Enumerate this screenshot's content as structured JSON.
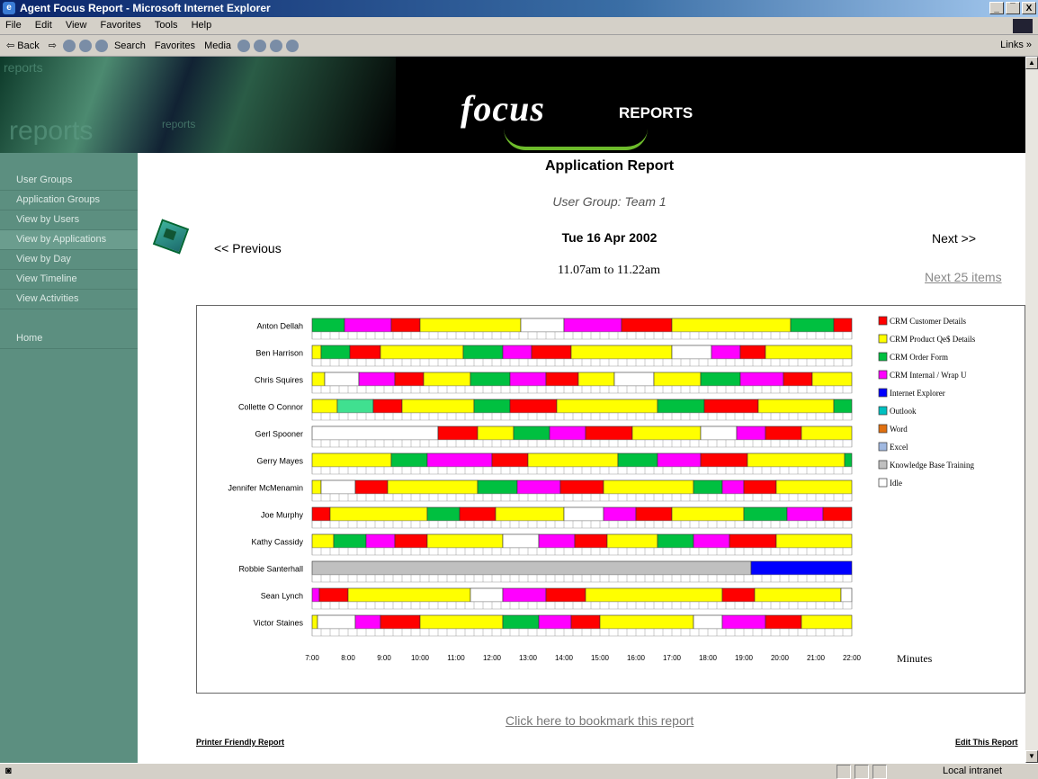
{
  "window": {
    "title": "Agent Focus Report - Microsoft Internet Explorer",
    "controls": [
      "_",
      "̅",
      "X"
    ]
  },
  "menu": [
    "File",
    "Edit",
    "View",
    "Favorites",
    "Tools",
    "Help"
  ],
  "toolbar": {
    "back": "⇦ Back",
    "forward": "⇨",
    "search": "Search",
    "favorites": "Favorites",
    "media": "Media",
    "links": "Links »"
  },
  "banner": {
    "brand": "focus",
    "subtitle": "REPORTS",
    "watermark": "reports"
  },
  "sidebar": {
    "items": [
      "User Groups",
      "Application Groups",
      "View by Users",
      "View by Applications",
      "View by Day",
      "View Timeline",
      "View Activities"
    ],
    "home": "Home",
    "active_index": 3
  },
  "report": {
    "title": "Application Report",
    "user_group": "User Group: Team 1",
    "date": "Tue 16 Apr 2002",
    "time_range": "11.07am to 11.22am",
    "prev": "<< Previous",
    "next": "Next >>",
    "next_items": "Next 25 items"
  },
  "chart_data": {
    "type": "timeline",
    "x_unit_label": "Minutes",
    "x_ticks": [
      "7:00",
      "8:00",
      "9:00",
      "10:00",
      "11:00",
      "12:00",
      "13:00",
      "14:00",
      "15:00",
      "16:00",
      "17:00",
      "18:00",
      "19:00",
      "20:00",
      "21:00",
      "22:00"
    ],
    "xlim": [
      7,
      22
    ],
    "legend": [
      {
        "name": "CRM Customer Details",
        "color": "#ff0000"
      },
      {
        "name": "CRM Product Qe$ Details",
        "color": "#ffff00"
      },
      {
        "name": "CRM Order Form",
        "color": "#00c040"
      },
      {
        "name": "CRM Internal / Wrap U",
        "color": "#ff00ff"
      },
      {
        "name": "Internet Explorer",
        "color": "#0000ff"
      },
      {
        "name": "Outlook",
        "color": "#00c0c0"
      },
      {
        "name": "Word",
        "color": "#e07010"
      },
      {
        "name": "Excel",
        "color": "#a0b8e0"
      },
      {
        "name": "Knowledge Base Training",
        "color": "#c0c0c0"
      },
      {
        "name": "Idle",
        "color": "#ffffff"
      }
    ],
    "colors": {
      "R": "#ff0000",
      "Y": "#ffff00",
      "G": "#00c040",
      "M": "#ff00ff",
      "B": "#0000ff",
      "T": "#00c0c0",
      "O": "#e07010",
      "E": "#a0b8e0",
      "K": "#c0c0c0",
      "W": "#ffffff",
      "L": "#40e090"
    },
    "rows": [
      {
        "name": "Anton Dellah",
        "segments": [
          [
            7.0,
            "G"
          ],
          [
            7.9,
            "M"
          ],
          [
            9.2,
            "R"
          ],
          [
            10.0,
            "Y"
          ],
          [
            12.8,
            "W"
          ],
          [
            14.0,
            "M"
          ],
          [
            15.6,
            "R"
          ],
          [
            17.0,
            "Y"
          ],
          [
            20.3,
            "G"
          ],
          [
            21.5,
            "R"
          ]
        ]
      },
      {
        "name": "Ben Harrison",
        "segments": [
          [
            7.0,
            "Y"
          ],
          [
            7.25,
            "G"
          ],
          [
            8.05,
            "R"
          ],
          [
            8.9,
            "Y"
          ],
          [
            11.2,
            "G"
          ],
          [
            12.3,
            "M"
          ],
          [
            13.1,
            "R"
          ],
          [
            14.2,
            "Y"
          ],
          [
            17.0,
            "W"
          ],
          [
            18.1,
            "M"
          ],
          [
            18.9,
            "R"
          ],
          [
            19.6,
            "Y"
          ]
        ]
      },
      {
        "name": "Chris Squires",
        "segments": [
          [
            7.0,
            "Y"
          ],
          [
            7.35,
            "W"
          ],
          [
            8.3,
            "M"
          ],
          [
            9.3,
            "R"
          ],
          [
            10.1,
            "Y"
          ],
          [
            11.4,
            "G"
          ],
          [
            12.5,
            "M"
          ],
          [
            13.5,
            "R"
          ],
          [
            14.4,
            "Y"
          ],
          [
            15.4,
            "W"
          ],
          [
            16.5,
            "Y"
          ],
          [
            17.8,
            "G"
          ],
          [
            18.9,
            "M"
          ],
          [
            20.1,
            "R"
          ],
          [
            20.9,
            "Y"
          ]
        ]
      },
      {
        "name": "Collette O Connor",
        "segments": [
          [
            7.0,
            "Y"
          ],
          [
            7.7,
            "L"
          ],
          [
            8.7,
            "R"
          ],
          [
            9.5,
            "Y"
          ],
          [
            11.5,
            "G"
          ],
          [
            12.5,
            "R"
          ],
          [
            13.8,
            "Y"
          ],
          [
            16.6,
            "G"
          ],
          [
            17.9,
            "R"
          ],
          [
            19.4,
            "Y"
          ],
          [
            21.5,
            "G"
          ]
        ]
      },
      {
        "name": "Gerl Spooner",
        "segments": [
          [
            7.0,
            "W"
          ],
          [
            10.5,
            "R"
          ],
          [
            11.6,
            "Y"
          ],
          [
            12.6,
            "G"
          ],
          [
            13.6,
            "M"
          ],
          [
            14.6,
            "R"
          ],
          [
            15.9,
            "Y"
          ],
          [
            17.8,
            "W"
          ],
          [
            18.8,
            "M"
          ],
          [
            19.6,
            "R"
          ],
          [
            20.6,
            "Y"
          ]
        ]
      },
      {
        "name": "Gerry Mayes",
        "segments": [
          [
            7.0,
            "Y"
          ],
          [
            9.2,
            "G"
          ],
          [
            10.2,
            "M"
          ],
          [
            12.0,
            "R"
          ],
          [
            13.0,
            "Y"
          ],
          [
            15.5,
            "G"
          ],
          [
            16.6,
            "M"
          ],
          [
            17.8,
            "R"
          ],
          [
            19.1,
            "Y"
          ],
          [
            21.8,
            "G"
          ]
        ]
      },
      {
        "name": "Jennifer McMenamin",
        "segments": [
          [
            7.0,
            "Y"
          ],
          [
            7.25,
            "W"
          ],
          [
            8.2,
            "R"
          ],
          [
            9.1,
            "Y"
          ],
          [
            11.6,
            "G"
          ],
          [
            12.7,
            "M"
          ],
          [
            13.9,
            "R"
          ],
          [
            15.1,
            "Y"
          ],
          [
            17.6,
            "G"
          ],
          [
            18.4,
            "M"
          ],
          [
            19.0,
            "R"
          ],
          [
            19.9,
            "Y"
          ]
        ]
      },
      {
        "name": "Joe Murphy",
        "segments": [
          [
            7.0,
            "R"
          ],
          [
            7.5,
            "Y"
          ],
          [
            10.2,
            "G"
          ],
          [
            11.1,
            "R"
          ],
          [
            12.1,
            "Y"
          ],
          [
            14.0,
            "W"
          ],
          [
            15.1,
            "M"
          ],
          [
            16.0,
            "R"
          ],
          [
            17.0,
            "Y"
          ],
          [
            19.0,
            "G"
          ],
          [
            20.2,
            "M"
          ],
          [
            21.2,
            "R"
          ]
        ]
      },
      {
        "name": "Kathy Cassidy",
        "segments": [
          [
            7.0,
            "Y"
          ],
          [
            7.6,
            "G"
          ],
          [
            8.5,
            "M"
          ],
          [
            9.3,
            "R"
          ],
          [
            10.2,
            "Y"
          ],
          [
            12.3,
            "W"
          ],
          [
            13.3,
            "M"
          ],
          [
            14.3,
            "R"
          ],
          [
            15.2,
            "Y"
          ],
          [
            16.6,
            "G"
          ],
          [
            17.6,
            "M"
          ],
          [
            18.6,
            "R"
          ],
          [
            19.9,
            "Y"
          ]
        ]
      },
      {
        "name": "Robbie Santerhall",
        "segments": [
          [
            7.0,
            "K"
          ],
          [
            19.2,
            "B"
          ]
        ]
      },
      {
        "name": "Sean Lynch",
        "segments": [
          [
            7.0,
            "M"
          ],
          [
            7.2,
            "R"
          ],
          [
            8.0,
            "Y"
          ],
          [
            11.4,
            "W"
          ],
          [
            12.3,
            "M"
          ],
          [
            13.5,
            "R"
          ],
          [
            14.6,
            "Y"
          ],
          [
            18.4,
            "R"
          ],
          [
            19.3,
            "Y"
          ],
          [
            21.7,
            "W"
          ]
        ]
      },
      {
        "name": "Victor Staines",
        "segments": [
          [
            7.0,
            "Y"
          ],
          [
            7.15,
            "W"
          ],
          [
            8.2,
            "M"
          ],
          [
            8.9,
            "R"
          ],
          [
            10.0,
            "Y"
          ],
          [
            12.3,
            "G"
          ],
          [
            13.3,
            "M"
          ],
          [
            14.2,
            "R"
          ],
          [
            15.0,
            "Y"
          ],
          [
            17.6,
            "W"
          ],
          [
            18.4,
            "M"
          ],
          [
            19.6,
            "R"
          ],
          [
            20.6,
            "Y"
          ]
        ]
      }
    ]
  },
  "footer": {
    "bookmark": "Click here to bookmark this report",
    "printer": "Printer Friendly Report",
    "edit": "Edit This Report"
  },
  "status": {
    "zone": "Local intranet"
  }
}
